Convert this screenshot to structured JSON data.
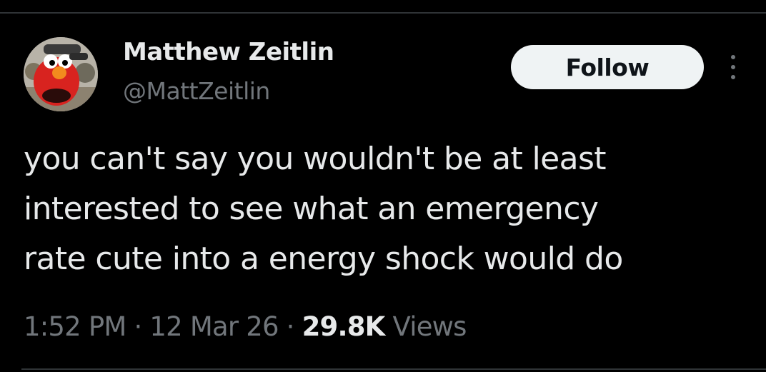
{
  "author": {
    "display_name": "Matthew Zeitlin",
    "handle": "@MattZeitlin",
    "avatar_description_icon": "profile-avatar"
  },
  "actions": {
    "follow_label": "Follow",
    "more_icon": "vertical-ellipsis-icon"
  },
  "tweet": {
    "lines": [
      "you can't say you wouldn't be at least",
      "interested to see what an emergency",
      "rate cute into a energy shock would do"
    ]
  },
  "meta": {
    "time": "1:52 PM",
    "separator": "·",
    "date": "12 Mar 26",
    "views_count": "29.8K",
    "views_label": "Views"
  },
  "colors": {
    "background": "#000000",
    "primary_text": "#e7e9ea",
    "secondary_text": "#71767b",
    "follow_bg": "#eff3f4",
    "follow_text": "#0f1419",
    "divider": "#2f3336"
  }
}
